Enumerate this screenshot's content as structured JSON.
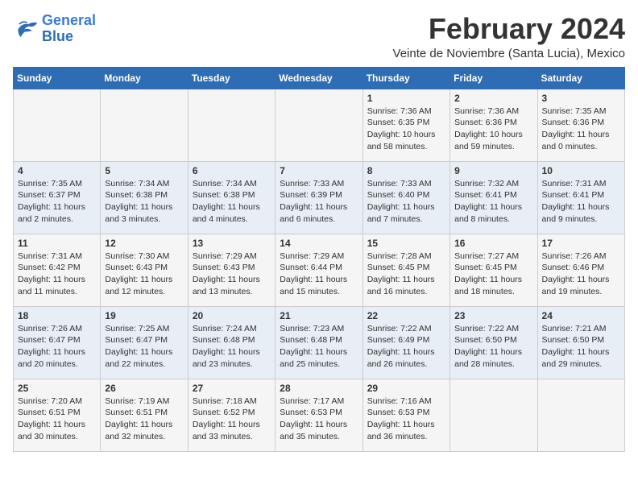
{
  "logo": {
    "text_general": "General",
    "text_blue": "Blue"
  },
  "header": {
    "month": "February 2024",
    "location": "Veinte de Noviembre (Santa Lucia), Mexico"
  },
  "days_of_week": [
    "Sunday",
    "Monday",
    "Tuesday",
    "Wednesday",
    "Thursday",
    "Friday",
    "Saturday"
  ],
  "weeks": [
    [
      {
        "day": "",
        "info": ""
      },
      {
        "day": "",
        "info": ""
      },
      {
        "day": "",
        "info": ""
      },
      {
        "day": "",
        "info": ""
      },
      {
        "day": "1",
        "info": "Sunrise: 7:36 AM\nSunset: 6:35 PM\nDaylight: 10 hours\nand 58 minutes."
      },
      {
        "day": "2",
        "info": "Sunrise: 7:36 AM\nSunset: 6:36 PM\nDaylight: 10 hours\nand 59 minutes."
      },
      {
        "day": "3",
        "info": "Sunrise: 7:35 AM\nSunset: 6:36 PM\nDaylight: 11 hours\nand 0 minutes."
      }
    ],
    [
      {
        "day": "4",
        "info": "Sunrise: 7:35 AM\nSunset: 6:37 PM\nDaylight: 11 hours\nand 2 minutes."
      },
      {
        "day": "5",
        "info": "Sunrise: 7:34 AM\nSunset: 6:38 PM\nDaylight: 11 hours\nand 3 minutes."
      },
      {
        "day": "6",
        "info": "Sunrise: 7:34 AM\nSunset: 6:38 PM\nDaylight: 11 hours\nand 4 minutes."
      },
      {
        "day": "7",
        "info": "Sunrise: 7:33 AM\nSunset: 6:39 PM\nDaylight: 11 hours\nand 6 minutes."
      },
      {
        "day": "8",
        "info": "Sunrise: 7:33 AM\nSunset: 6:40 PM\nDaylight: 11 hours\nand 7 minutes."
      },
      {
        "day": "9",
        "info": "Sunrise: 7:32 AM\nSunset: 6:41 PM\nDaylight: 11 hours\nand 8 minutes."
      },
      {
        "day": "10",
        "info": "Sunrise: 7:31 AM\nSunset: 6:41 PM\nDaylight: 11 hours\nand 9 minutes."
      }
    ],
    [
      {
        "day": "11",
        "info": "Sunrise: 7:31 AM\nSunset: 6:42 PM\nDaylight: 11 hours\nand 11 minutes."
      },
      {
        "day": "12",
        "info": "Sunrise: 7:30 AM\nSunset: 6:43 PM\nDaylight: 11 hours\nand 12 minutes."
      },
      {
        "day": "13",
        "info": "Sunrise: 7:29 AM\nSunset: 6:43 PM\nDaylight: 11 hours\nand 13 minutes."
      },
      {
        "day": "14",
        "info": "Sunrise: 7:29 AM\nSunset: 6:44 PM\nDaylight: 11 hours\nand 15 minutes."
      },
      {
        "day": "15",
        "info": "Sunrise: 7:28 AM\nSunset: 6:45 PM\nDaylight: 11 hours\nand 16 minutes."
      },
      {
        "day": "16",
        "info": "Sunrise: 7:27 AM\nSunset: 6:45 PM\nDaylight: 11 hours\nand 18 minutes."
      },
      {
        "day": "17",
        "info": "Sunrise: 7:26 AM\nSunset: 6:46 PM\nDaylight: 11 hours\nand 19 minutes."
      }
    ],
    [
      {
        "day": "18",
        "info": "Sunrise: 7:26 AM\nSunset: 6:47 PM\nDaylight: 11 hours\nand 20 minutes."
      },
      {
        "day": "19",
        "info": "Sunrise: 7:25 AM\nSunset: 6:47 PM\nDaylight: 11 hours\nand 22 minutes."
      },
      {
        "day": "20",
        "info": "Sunrise: 7:24 AM\nSunset: 6:48 PM\nDaylight: 11 hours\nand 23 minutes."
      },
      {
        "day": "21",
        "info": "Sunrise: 7:23 AM\nSunset: 6:48 PM\nDaylight: 11 hours\nand 25 minutes."
      },
      {
        "day": "22",
        "info": "Sunrise: 7:22 AM\nSunset: 6:49 PM\nDaylight: 11 hours\nand 26 minutes."
      },
      {
        "day": "23",
        "info": "Sunrise: 7:22 AM\nSunset: 6:50 PM\nDaylight: 11 hours\nand 28 minutes."
      },
      {
        "day": "24",
        "info": "Sunrise: 7:21 AM\nSunset: 6:50 PM\nDaylight: 11 hours\nand 29 minutes."
      }
    ],
    [
      {
        "day": "25",
        "info": "Sunrise: 7:20 AM\nSunset: 6:51 PM\nDaylight: 11 hours\nand 30 minutes."
      },
      {
        "day": "26",
        "info": "Sunrise: 7:19 AM\nSunset: 6:51 PM\nDaylight: 11 hours\nand 32 minutes."
      },
      {
        "day": "27",
        "info": "Sunrise: 7:18 AM\nSunset: 6:52 PM\nDaylight: 11 hours\nand 33 minutes."
      },
      {
        "day": "28",
        "info": "Sunrise: 7:17 AM\nSunset: 6:53 PM\nDaylight: 11 hours\nand 35 minutes."
      },
      {
        "day": "29",
        "info": "Sunrise: 7:16 AM\nSunset: 6:53 PM\nDaylight: 11 hours\nand 36 minutes."
      },
      {
        "day": "",
        "info": ""
      },
      {
        "day": "",
        "info": ""
      }
    ]
  ]
}
